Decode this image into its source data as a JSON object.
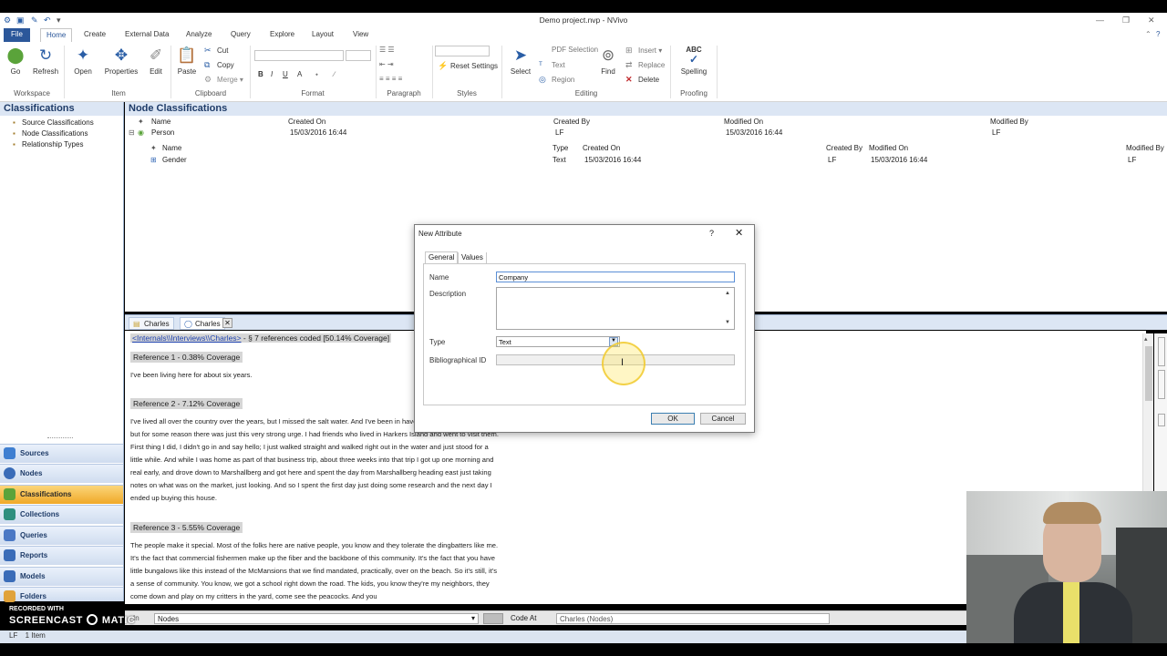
{
  "window": {
    "title": "Demo project.nvp - NVivo",
    "qat_icons": [
      "nvivo-logo-icon",
      "save-icon",
      "edit-icon",
      "undo-icon",
      "customize-icon"
    ]
  },
  "ribbon": {
    "tabs": [
      {
        "label": "File"
      },
      {
        "label": "Home"
      },
      {
        "label": "Create"
      },
      {
        "label": "External Data"
      },
      {
        "label": "Analyze"
      },
      {
        "label": "Query"
      },
      {
        "label": "Explore"
      },
      {
        "label": "Layout"
      },
      {
        "label": "View"
      }
    ],
    "groups": {
      "workspace": {
        "label": "Workspace",
        "go": "Go",
        "refresh": "Refresh"
      },
      "item": {
        "label": "Item",
        "open": "Open",
        "properties": "Properties",
        "edit": "Edit"
      },
      "clipboard": {
        "label": "Clipboard",
        "paste": "Paste",
        "cut": "Cut",
        "copy": "Copy",
        "merge": "Merge"
      },
      "format": {
        "label": "Format",
        "bold": "B",
        "italic": "I",
        "underline": "U",
        "font_color": "A"
      },
      "paragraph": {
        "label": "Paragraph"
      },
      "styles": {
        "label": "Styles",
        "reset_settings": "Reset Settings"
      },
      "editing": {
        "label": "Editing",
        "select": "Select",
        "pdf_selection": "PDF Selection",
        "text": "Text",
        "region": "Region",
        "find": "Find",
        "insert": "Insert",
        "replace": "Replace",
        "delete": "Delete"
      },
      "proofing": {
        "label": "Proofing",
        "spelling": "Spelling",
        "spelling_icon_text": "ABC"
      }
    }
  },
  "navigation": {
    "header": "Classifications",
    "tree": [
      {
        "label": "Source Classifications"
      },
      {
        "label": "Node Classifications"
      },
      {
        "label": "Relationship Types"
      }
    ],
    "buttons": [
      {
        "label": "Sources",
        "color": "#3f7fd1"
      },
      {
        "label": "Nodes",
        "color": "#3a6cb8"
      },
      {
        "label": "Classifications",
        "color": "#5aa33a",
        "selected": true
      },
      {
        "label": "Collections",
        "color": "#2f8f7f"
      },
      {
        "label": "Queries",
        "color": "#4b78c4"
      },
      {
        "label": "Reports",
        "color": "#3a6cb8"
      },
      {
        "label": "Models",
        "color": "#3a6cb8"
      },
      {
        "label": "Folders",
        "color": "#e0a23a"
      }
    ]
  },
  "list": {
    "header": "Node Classifications",
    "columns": [
      "Name",
      "Created On",
      "Created By",
      "Modified On",
      "Modified By"
    ],
    "row": {
      "name": "Person",
      "created_on": "15/03/2016 16:44",
      "created_by": "LF",
      "modified_on": "15/03/2016 16:44",
      "modified_by": "LF"
    },
    "sub_columns": [
      "Name",
      "Type",
      "Created On",
      "Created By",
      "Modified On",
      "Modified By"
    ],
    "sub_row": {
      "name": "Gender",
      "type": "Text",
      "created_on": "15/03/2016 16:44",
      "created_by": "LF",
      "modified_on": "15/03/2016 16:44",
      "modified_by": "LF"
    }
  },
  "detail": {
    "tabs": [
      {
        "label": "Charles"
      },
      {
        "label": "Charles"
      }
    ],
    "source_link": "<Internals\\\\Interviews\\\\Charles>",
    "source_summary": "- § 7 references coded  [50.14% Coverage]",
    "references": [
      {
        "heading": "Reference 1 - 0.38% Coverage",
        "text": "I've been living here for about six years."
      },
      {
        "heading": "Reference 2 - 7.12% Coverage",
        "text": "I've lived all over the country over the years, but I missed the salt water. And I've been in haven't been in that salt water but for some reason there was just this very strong urge. I had friends who lived in Harkers Island and went to visit them. First thing I did, I didn't go in and say hello; I just walked straight and walked right out in the water and just stood for a little while. And while I was home as part of that business trip, about three weeks into that trip I got up one morning and real early, and drove down to Marshallberg and got here and spent the day from Marshallberg heading east just taking notes on what was on the market, just looking. And so I spent the first day just doing some research and the next day I ended up buying this house."
      },
      {
        "heading": "Reference 3 - 5.55% Coverage",
        "text": "The people make it special. Most of the folks here are native people, you know and they tolerate the dingbatters like me. It's the fact that commercial fishermen make up the fiber and the backbone of this community. It's the fact that you have little bungalows like this instead of the McMansions that we find mandated, practically, over on the beach. So it's still, it's a sense of community. You know, we got a school right down the road. The kids, you know they're my neighbors, they come down and play on my critters in the yard, come see the peacocks. And you"
      }
    ]
  },
  "codebar": {
    "in_label": "In",
    "scope": "Nodes",
    "code_at": "Code At",
    "code_target": "Charles (Nodes)"
  },
  "status": {
    "user": "LF",
    "items": "1 Item"
  },
  "watermark": {
    "line1": "RECORDED WITH",
    "line2": "SCREENCAST",
    "line3": "MATIC"
  },
  "dialog": {
    "title": "New Attribute",
    "help": "?",
    "tabs": [
      {
        "label": "General"
      },
      {
        "label": "Values"
      }
    ],
    "name_label": "Name",
    "name_value": "Company",
    "description_label": "Description",
    "description_value": "",
    "type_label": "Type",
    "type_value": "Text",
    "bib_label": "Bibliographical ID",
    "bib_value": "",
    "ok": "OK",
    "cancel": "Cancel"
  }
}
